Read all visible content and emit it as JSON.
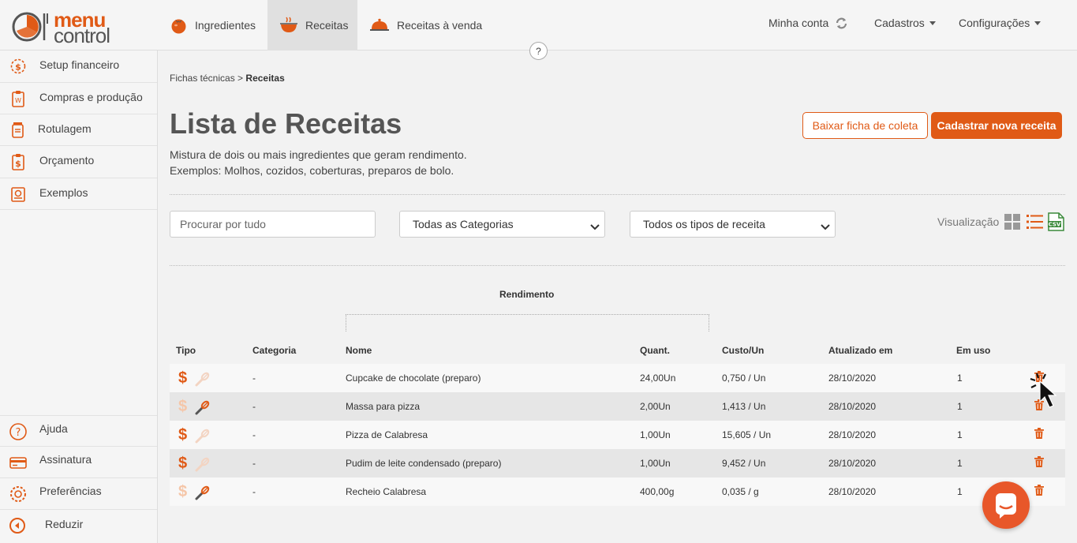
{
  "app": {
    "logo_text_1": "menu",
    "logo_text_2": "control"
  },
  "topnav": {
    "tabs": [
      {
        "label": "Ingredientes",
        "icon": "tomato-icon"
      },
      {
        "label": "Receitas",
        "icon": "cooking-pot-icon",
        "active": true
      },
      {
        "label": "Receitas à venda",
        "icon": "serving-dish-icon"
      }
    ],
    "account": "Minha conta",
    "cadastros": "Cadastros",
    "config": "Configurações",
    "help": "?"
  },
  "sidebar": {
    "items": [
      {
        "label": "Setup financeiro",
        "icon": "gear-dollar-icon"
      },
      {
        "label": "Compras e produção",
        "icon": "clipboard-icon"
      },
      {
        "label": "Rotulagem",
        "icon": "jar-label-icon"
      },
      {
        "label": "Orçamento",
        "icon": "budget-clipboard-icon"
      },
      {
        "label": "Exemplos",
        "icon": "book-icon"
      }
    ],
    "bottom": [
      {
        "label": "Ajuda",
        "icon": "question-icon"
      },
      {
        "label": "Assinatura",
        "icon": "credit-card-icon"
      },
      {
        "label": "Preferências",
        "icon": "settings-icon"
      },
      {
        "label": "Reduzir",
        "icon": "collapse-icon"
      }
    ]
  },
  "page": {
    "breadcrumb_parent": "Fichas técnicas",
    "breadcrumb_sep": ">",
    "breadcrumb_current": "Receitas",
    "title": "Lista de Receitas",
    "desc_line1": "Mistura de dois ou mais ingredientes que geram rendimento.",
    "desc_line2": "Exemplos: Molhos, cozidos, coberturas, preparos de bolo.",
    "btn_download": "Baixar ficha de coleta",
    "btn_new": "Cadastrar nova receita"
  },
  "filters": {
    "search_placeholder": "Procurar por tudo",
    "category": "Todas as Categorias",
    "type": "Todos os tipos de receita",
    "view_label": "Visualização"
  },
  "table": {
    "group_header": "Rendimento",
    "headers": [
      "Tipo",
      "Categoria",
      "Nome",
      "Quant.",
      "Custo/Un",
      "Atualizado em",
      "Em uso"
    ],
    "rows": [
      {
        "dollar_active": true,
        "whisk_active": false,
        "categoria": "-",
        "nome": "Cupcake de chocolate (preparo)",
        "quant": "24,00Un",
        "custo": "0,750 / Un",
        "data": "28/10/2020",
        "em_uso": "1"
      },
      {
        "dollar_active": false,
        "whisk_active": true,
        "categoria": "-",
        "nome": "Massa para pizza",
        "quant": "2,00Un",
        "custo": "1,413 / Un",
        "data": "28/10/2020",
        "em_uso": "1"
      },
      {
        "dollar_active": true,
        "whisk_active": false,
        "categoria": "-",
        "nome": "Pizza de Calabresa",
        "quant": "1,00Un",
        "custo": "15,605 / Un",
        "data": "28/10/2020",
        "em_uso": "1"
      },
      {
        "dollar_active": true,
        "whisk_active": false,
        "categoria": "-",
        "nome": "Pudim de leite condensado (preparo)",
        "quant": "1,00Un",
        "custo": "9,452 / Un",
        "data": "28/10/2020",
        "em_uso": "1"
      },
      {
        "dollar_active": false,
        "whisk_active": true,
        "categoria": "-",
        "nome": "Recheio Calabresa",
        "quant": "400,00g",
        "custo": "0,035 / g",
        "data": "28/10/2020",
        "em_uso": "1"
      }
    ]
  },
  "colors": {
    "accent": "#e05a16",
    "chat": "#e8572a"
  }
}
